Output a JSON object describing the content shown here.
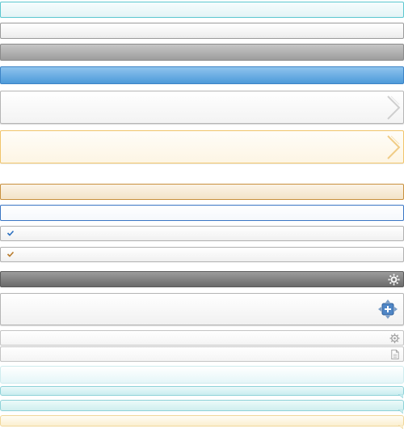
{
  "icons": {
    "row5": "chevron-right-icon",
    "row6": "chevron-right-icon",
    "row9": "checkmark-icon",
    "row10": "checkmark-icon",
    "row11": "gear-icon",
    "row12": "move-plus-icon",
    "row13": "gear-icon",
    "row14": "document-icon"
  },
  "colors": {
    "teal": "#5cc7cf",
    "blue": "#4d9ad9",
    "gray": "#9d9d9d",
    "dark_gray": "#6b6b6b",
    "orange": "#c8903e",
    "gold": "#f0c46a"
  }
}
